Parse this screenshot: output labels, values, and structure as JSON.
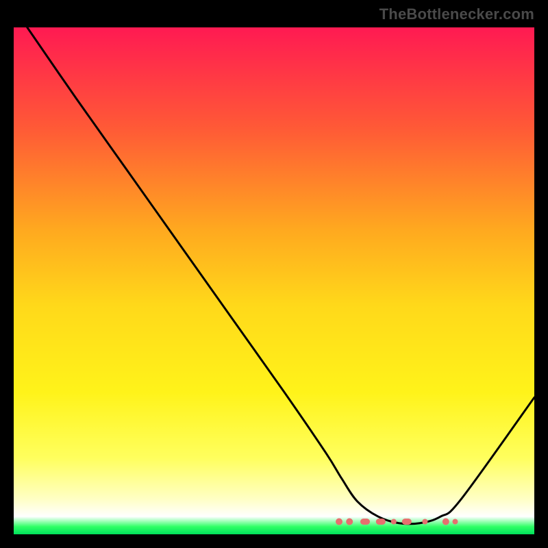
{
  "watermark": "TheBottlenecker.com",
  "chart_data": {
    "type": "line",
    "title": "",
    "xlabel": "",
    "ylabel": "",
    "xlim": [
      0,
      100
    ],
    "ylim": [
      0,
      100
    ],
    "gradient_stops": [
      {
        "offset": 0.0,
        "color": "#ff1a52"
      },
      {
        "offset": 0.2,
        "color": "#ff5a36"
      },
      {
        "offset": 0.4,
        "color": "#ffa91f"
      },
      {
        "offset": 0.55,
        "color": "#ffd91a"
      },
      {
        "offset": 0.72,
        "color": "#fff31a"
      },
      {
        "offset": 0.85,
        "color": "#ffff5e"
      },
      {
        "offset": 0.93,
        "color": "#ffffc4"
      },
      {
        "offset": 0.965,
        "color": "#ffffff"
      },
      {
        "offset": 0.985,
        "color": "#2fff66"
      },
      {
        "offset": 1.0,
        "color": "#00e05a"
      }
    ],
    "series": [
      {
        "name": "bottleneck-curve",
        "x": [
          2.6,
          12,
          22,
          32,
          42,
          52,
          60,
          63,
          66,
          70,
          74,
          78,
          82,
          86,
          100
        ],
        "y": [
          100,
          86,
          71.5,
          57,
          42.5,
          28,
          16,
          11,
          6.5,
          3.5,
          2.2,
          2.2,
          3.5,
          7,
          27
        ]
      }
    ],
    "markers": {
      "name": "highlighted-points",
      "color": "#e76f6f",
      "approx_y": 2.5,
      "points": [
        {
          "x": 62.5,
          "shape": "dot",
          "r": 5
        },
        {
          "x": 64.5,
          "shape": "dot",
          "r": 5
        },
        {
          "x": 67.5,
          "shape": "pill",
          "w": 14
        },
        {
          "x": 70.5,
          "shape": "pill",
          "w": 14
        },
        {
          "x": 73.0,
          "shape": "dot",
          "r": 4
        },
        {
          "x": 75.5,
          "shape": "pill",
          "w": 14
        },
        {
          "x": 79.0,
          "shape": "dot",
          "r": 4
        },
        {
          "x": 83.0,
          "shape": "dot",
          "r": 5
        },
        {
          "x": 84.8,
          "shape": "dot",
          "r": 4
        }
      ]
    }
  }
}
